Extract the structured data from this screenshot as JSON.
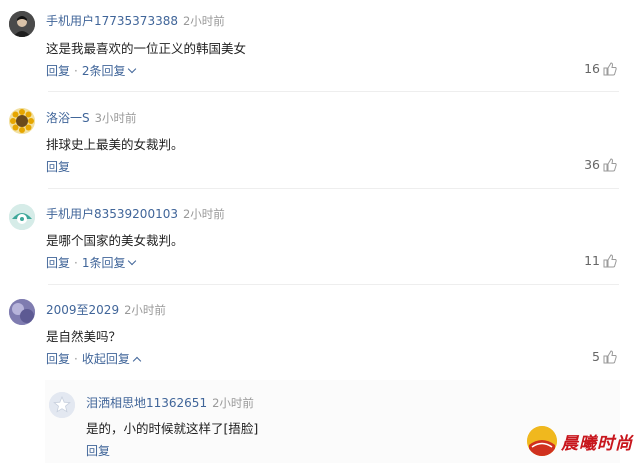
{
  "comments": [
    {
      "user": "手机用户17735373388",
      "time": "2小时前",
      "text": "这是我最喜欢的一位正义的韩国美女",
      "reply_label": "回复",
      "replies_label": "2条回复",
      "likes": "16"
    },
    {
      "user": "洛浴一S",
      "time": "3小时前",
      "text": "排球史上最美的女裁判。",
      "reply_label": "回复",
      "likes": "36"
    },
    {
      "user": "手机用户83539200103",
      "time": "2小时前",
      "text": "是哪个国家的美女裁判。",
      "reply_label": "回复",
      "replies_label": "1条回复",
      "likes": "11"
    },
    {
      "user": "2009至2029",
      "time": "2小时前",
      "text": "是自然美吗？",
      "reply_label": "回复",
      "replies_label": "收起回复",
      "likes": "5"
    }
  ],
  "reply": {
    "user": "泪洒相思地11362651",
    "time": "2小时前",
    "text": "是的，小的时候就这样了[捂脸]",
    "reply_label": "回复"
  },
  "watermark": "晨曦时尚",
  "colors": {
    "link": "#406599",
    "time": "#999999",
    "watermark": "#c8161d"
  },
  "icons": [
    "thumbs-up-icon",
    "chevron-down-icon",
    "chevron-up-icon",
    "sunflower-avatar",
    "star-avatar"
  ]
}
